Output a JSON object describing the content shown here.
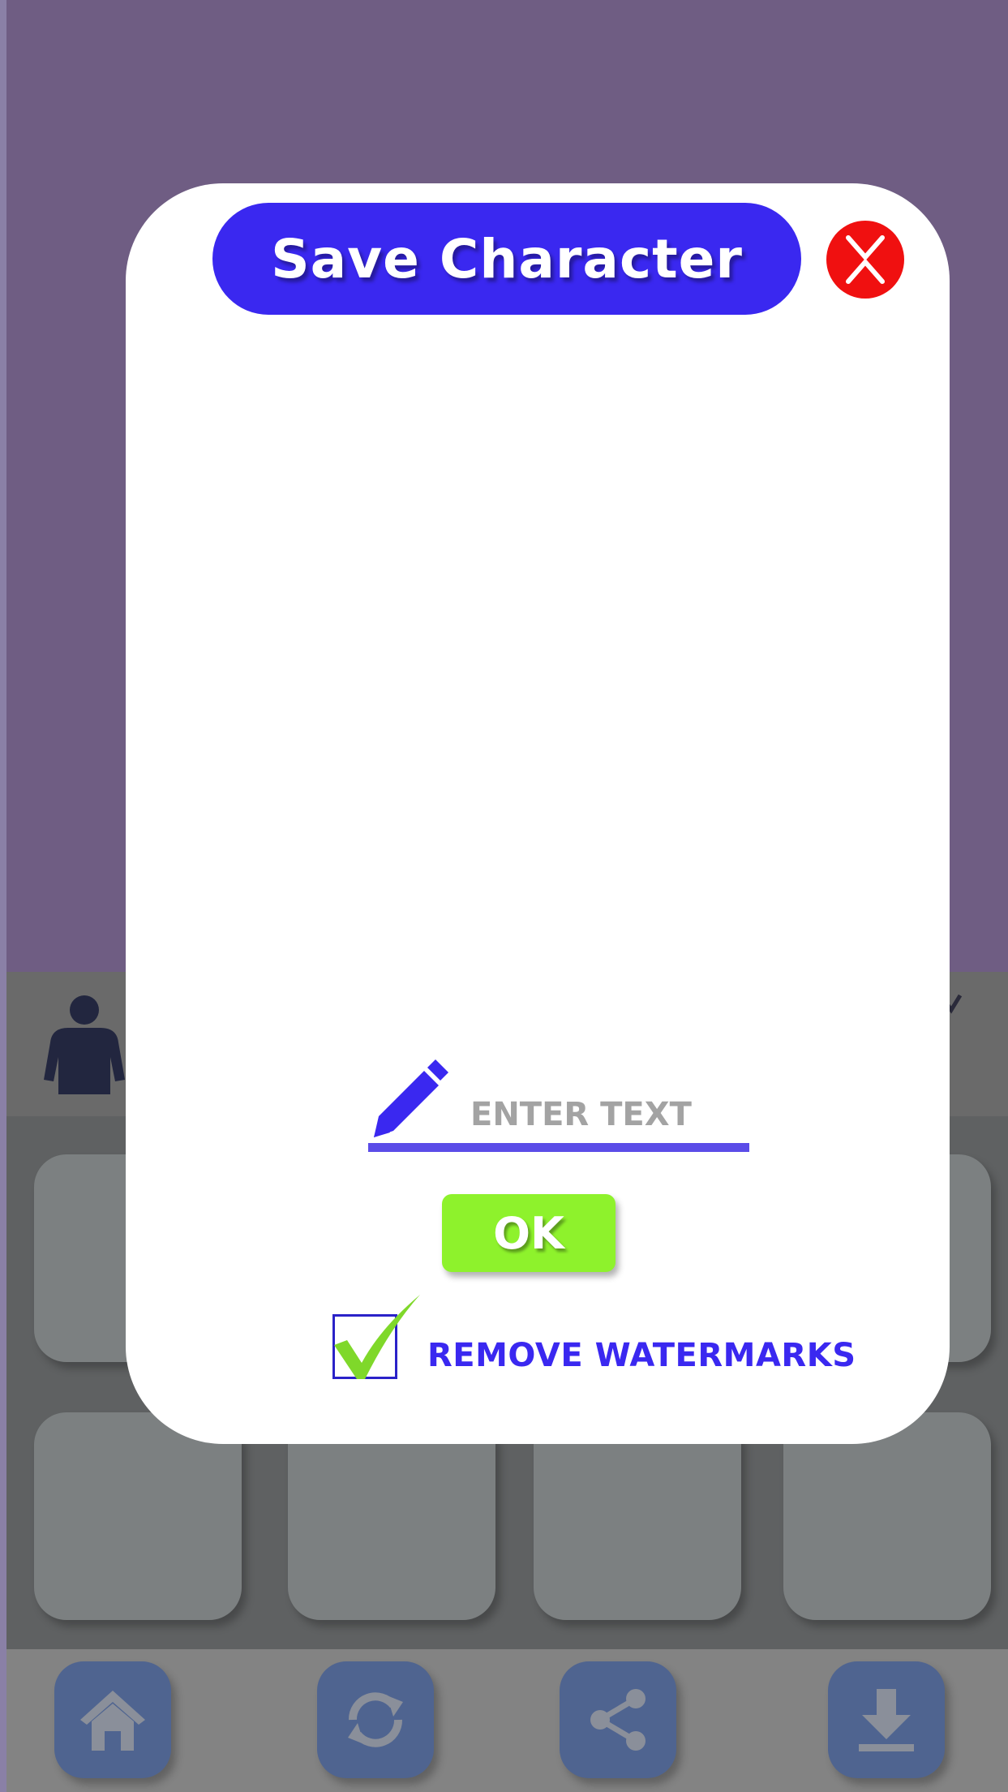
{
  "dialog": {
    "title": "Save Character",
    "input_placeholder": "ENTER TEXT",
    "input_value": "",
    "ok_label": "OK",
    "remove_watermarks_label": "REMOVE WATERMARKS",
    "remove_watermarks_checked": true
  },
  "icons": {
    "close": "close-icon",
    "pencil": "pencil-icon",
    "character": "person-icon",
    "home": "home-icon",
    "refresh": "refresh-icon",
    "share": "share-icon",
    "download": "download-icon"
  },
  "colors": {
    "title_pill": "#3a28f0",
    "close": "#f01010",
    "ok": "#8ef22c",
    "nav_button": "#4f6490",
    "backdrop": "#6f5d83"
  }
}
